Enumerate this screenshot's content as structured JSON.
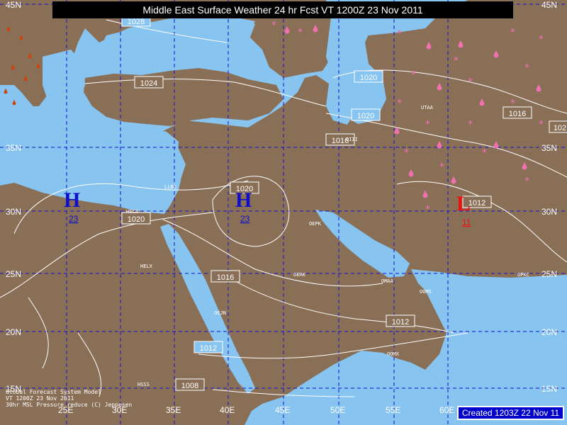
{
  "title": "Middle East Surface Weather 24 hr Fcst   VT 1200Z 23 Nov 2011",
  "created": "Created 1203Z 22 Nov 11",
  "footer": {
    "line1": "Global Forecast System Model",
    "line2": "VT 1200Z 23 Nov 2011",
    "line3": "30hr MSL Pressure reduce  (C) Jeppesen"
  },
  "colors": {
    "sea": "#87c4f0",
    "land": "#8a6f57",
    "grid": "#1212d0",
    "high": "#1010cc",
    "low": "#ee1010",
    "rain": "#f070b0",
    "snow": "#f070b0",
    "isobar": "#ffffff"
  },
  "latitude_labels": [
    "45N",
    "35N",
    "30N",
    "25N",
    "20N",
    "15N"
  ],
  "longitude_labels": [
    "25E",
    "30E",
    "35E",
    "40E",
    "45E",
    "50E",
    "55E",
    "60E"
  ],
  "isobars": [
    "1028",
    "1024",
    "1020",
    "1020",
    "1016",
    "1016",
    "1020",
    "1020",
    "1016",
    "1016",
    "1012",
    "1012",
    "1012",
    "1008",
    "102"
  ],
  "pressure_centers": [
    {
      "type": "H",
      "value": "23"
    },
    {
      "type": "H",
      "value": "23"
    },
    {
      "type": "L",
      "value": "11"
    }
  ],
  "stations": [
    "HELX",
    "HECA",
    "LLBG",
    "OERK",
    "OEPK",
    "OEJN",
    "HSSS",
    "OOMS",
    "OMAA",
    "OOMX",
    "OPKC",
    "UTAA",
    "OIII"
  ]
}
